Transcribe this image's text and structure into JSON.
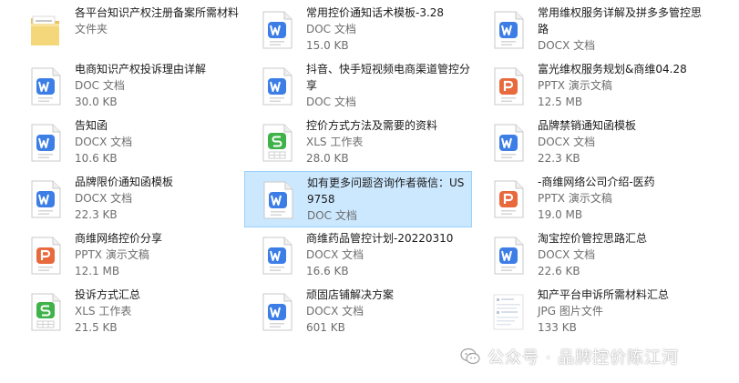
{
  "files": [
    {
      "name": "各平台知识产权注册备案所需材料",
      "type": "文件夹",
      "size": "",
      "icon": "folder-icon"
    },
    {
      "name": "常用控价通知话术模板-3.28",
      "type": "DOC 文档",
      "size": "15.0 KB",
      "icon": "word-doc-icon"
    },
    {
      "name": "常用维权服务详解及拼多多管控思路",
      "type": "DOCX 文档",
      "size": "",
      "icon": "word-doc-icon"
    },
    {
      "name": "电商知识产权投诉理由详解",
      "type": "DOC 文档",
      "size": "30.0 KB",
      "icon": "word-doc-icon"
    },
    {
      "name": "抖音、快手短视频电商渠道管控分享",
      "type": "DOC 文档",
      "size": "",
      "icon": "word-doc-icon"
    },
    {
      "name": "富光维权服务规划&商维04.28",
      "type": "PPTX 演示文稿",
      "size": "12.5 MB",
      "icon": "ppt-icon"
    },
    {
      "name": "告知函",
      "type": "DOCX 文档",
      "size": "10.6 KB",
      "icon": "word-doc-icon"
    },
    {
      "name": "控价方式方法及需要的资料",
      "type": "XLS 工作表",
      "size": "28.0 KB",
      "icon": "excel-sheet-icon"
    },
    {
      "name": "品牌禁销通知函模板",
      "type": "DOCX 文档",
      "size": "22.3 KB",
      "icon": "word-doc-icon"
    },
    {
      "name": "品牌限价通知函模板",
      "type": "DOCX 文档",
      "size": "22.3 KB",
      "icon": "word-doc-icon"
    },
    {
      "name": "如有更多问题咨询作者薇信：US9758",
      "type": "DOC 文档",
      "size": "",
      "icon": "word-doc-icon",
      "selected": true
    },
    {
      "name": "-商维网络公司介绍-医药",
      "type": "PPTX 演示文稿",
      "size": "19.0 MB",
      "icon": "ppt-icon"
    },
    {
      "name": "商维网络控价分享",
      "type": "PPTX 演示文稿",
      "size": "12.1 MB",
      "icon": "ppt-icon"
    },
    {
      "name": "商维药品管控计划-20220310",
      "type": "DOCX 文档",
      "size": "16.6 KB",
      "icon": "word-doc-icon"
    },
    {
      "name": "淘宝控价管控思路汇总",
      "type": "DOCX 文档",
      "size": "22.6 KB",
      "icon": "word-doc-icon"
    },
    {
      "name": "投诉方式汇总",
      "type": "XLS 工作表",
      "size": "21.5 KB",
      "icon": "excel-sheet-icon"
    },
    {
      "name": "顽固店铺解决方案",
      "type": "DOCX 文档",
      "size": "601 KB",
      "icon": "word-doc-icon"
    },
    {
      "name": "知产平台申诉所需材料汇总",
      "type": "JPG 图片文件",
      "size": "133 KB",
      "icon": "image-thumbnail-icon"
    }
  ],
  "watermark": {
    "text": "公众号 · 品牌控价陈江河",
    "icon": "wechat-icon"
  }
}
